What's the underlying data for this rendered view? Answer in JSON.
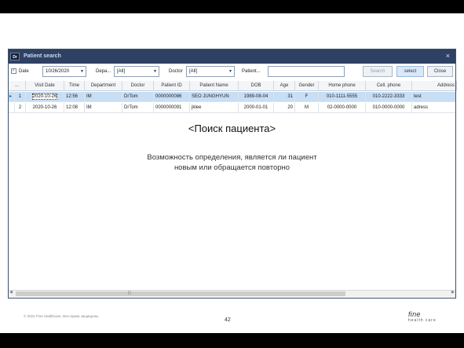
{
  "window": {
    "icon_text": "Dr",
    "title": "Patient search",
    "close_glyph": "×"
  },
  "toolbar": {
    "date_checked": "✓",
    "date_label": "Date",
    "date_value": "10/26/2020",
    "department_label": "Depa...",
    "department_value": "[All]",
    "doctor_label": "Doctor",
    "doctor_value": "[All]",
    "patient_label": "Patient...",
    "patient_value": "",
    "search_label": "Search",
    "select_label": "select",
    "close_label": "Close",
    "dropdown_arrow": "▼"
  },
  "table": {
    "headers": [
      "...",
      "Visit Date",
      "Time",
      "Department",
      "Doctor",
      "Patient ID",
      "Patient Name",
      "DOB",
      "Age",
      "Gender",
      "Home phone",
      "Cell. phone",
      "Address"
    ],
    "rows": [
      {
        "indicator": "▸",
        "num": "1",
        "visit_date": "2020-10-26",
        "time": "12:56",
        "department": "IM",
        "doctor": "DrTom",
        "patient_id": "0000000086",
        "patient_name": "SEO JUNGHYUN",
        "dob": "1989-08-04",
        "age": "31",
        "gender": "F",
        "home_phone": "010-1111-5555",
        "cell_phone": "010-2222-3333",
        "address": "test"
      },
      {
        "indicator": "",
        "num": "2",
        "visit_date": "2020-10-26",
        "time": "12:08",
        "department": "IM",
        "doctor": "DrTom",
        "patient_id": "0000000091",
        "patient_name": "jklee",
        "dob": "2000-01-01",
        "age": "20",
        "gender": "M",
        "home_phone": "02-0000-0000",
        "cell_phone": "010-0000-0000",
        "address": "adress"
      }
    ]
  },
  "scrollbar": {
    "left_arrow": "◀",
    "right_arrow": "▶",
    "grip": "|||"
  },
  "overlay": {
    "title": "<Поиск пациента>",
    "description_line1": "Возможность определения, является ли пациент",
    "description_line2": "новым или обращается повторно"
  },
  "footer": {
    "copyright": "© 2021 Fine Healthcare. Все права защищены.",
    "page_number": "42",
    "logo_line1": "fine",
    "logo_line2": "health care"
  }
}
